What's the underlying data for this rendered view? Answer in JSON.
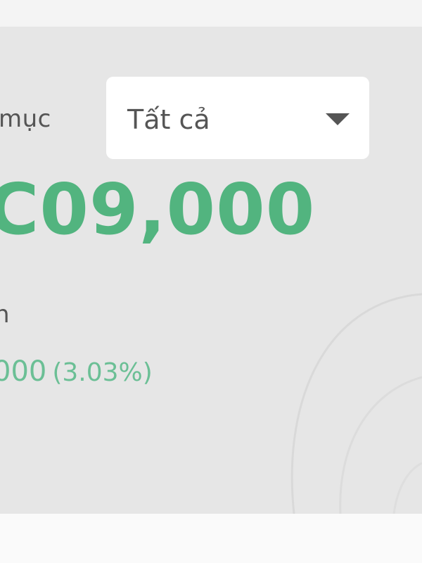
{
  "filter": {
    "label_partial": "mục",
    "selected": "Tất cả"
  },
  "summary": {
    "total_value_partial": "C09,000",
    "profit_label_partial": "n",
    "profit_value_partial": "000",
    "profit_percent": "(3.03%)"
  },
  "colors": {
    "accent": "#52b47f",
    "text_muted": "#555555",
    "card_background": "#e6e6e6"
  },
  "icons": {
    "dropdown": "chevron-down-icon"
  }
}
